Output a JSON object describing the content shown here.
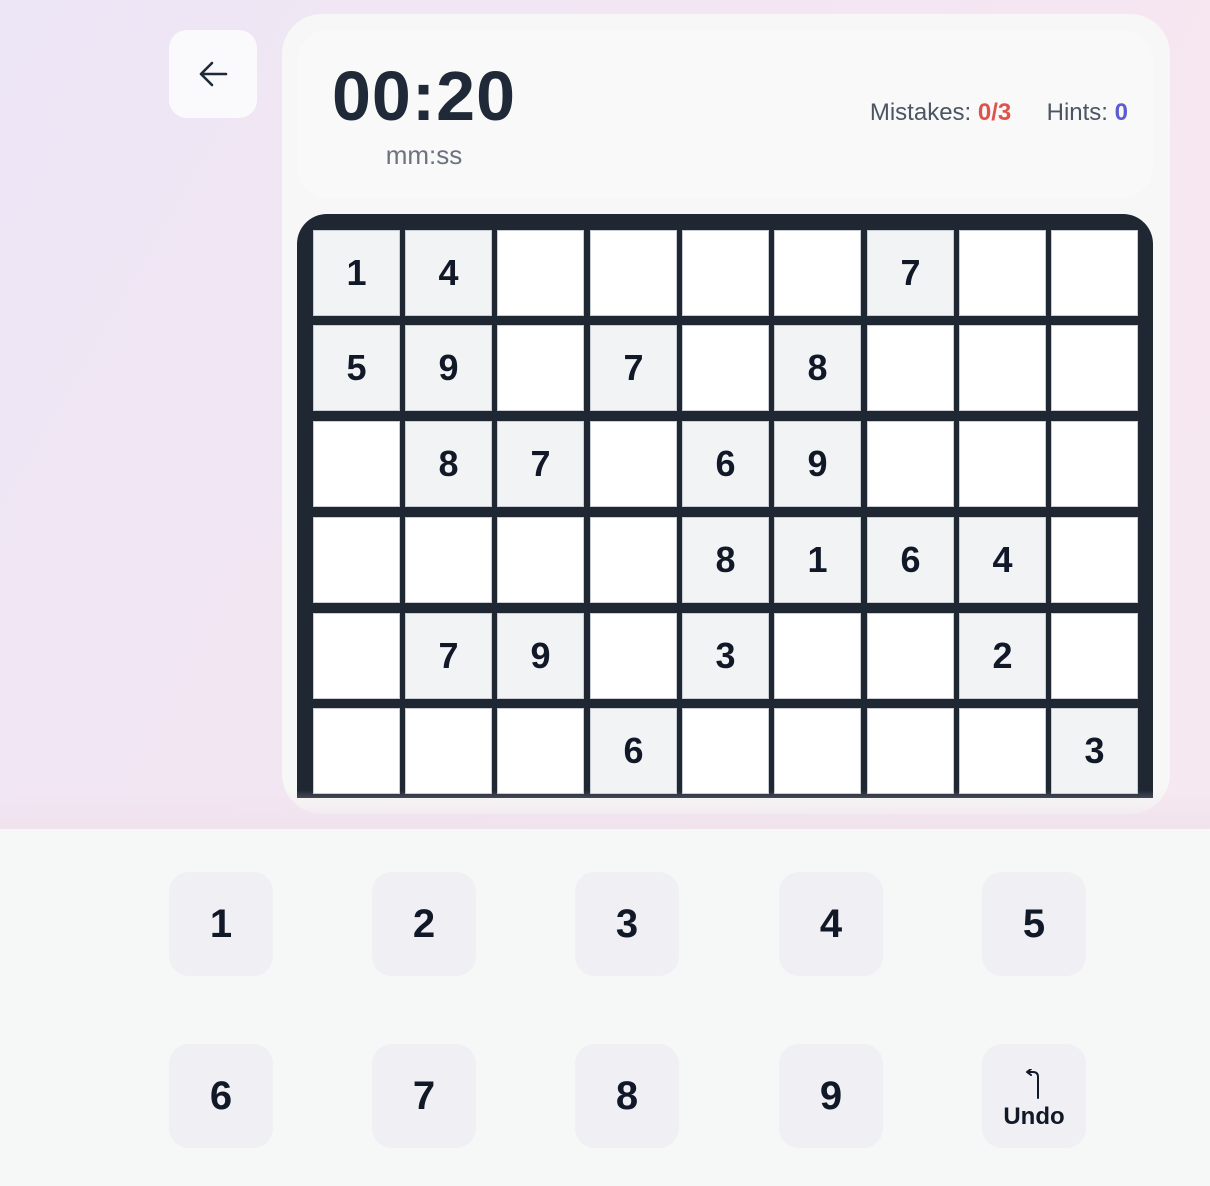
{
  "header": {
    "back_icon": "arrow-left-icon",
    "timer": "00:20",
    "timer_unit": "mm:ss",
    "mistakes_label": "Mistakes:",
    "mistakes_value": "0/3",
    "hints_label": "Hints:",
    "hints_value": "0"
  },
  "colors": {
    "mistakes": "#e0524a",
    "hints": "#5b5bd6",
    "board_border": "#1f2733"
  },
  "board": {
    "rows": [
      [
        "1",
        "4",
        "",
        "",
        "",
        "",
        "7",
        "",
        ""
      ],
      [
        "5",
        "9",
        "",
        "7",
        "",
        "8",
        "",
        "",
        ""
      ],
      [
        "",
        "8",
        "7",
        "",
        "6",
        "9",
        "",
        "",
        ""
      ],
      [
        "",
        "",
        "",
        "",
        "8",
        "1",
        "6",
        "4",
        ""
      ],
      [
        "",
        "7",
        "9",
        "",
        "3",
        "",
        "",
        "2",
        ""
      ],
      [
        "",
        "",
        "",
        "6",
        "",
        "",
        "",
        "",
        "3"
      ]
    ]
  },
  "keypad": {
    "keys": [
      "1",
      "2",
      "3",
      "4",
      "5",
      "6",
      "7",
      "8",
      "9"
    ],
    "undo_label": "Undo",
    "undo_icon": "undo-icon"
  }
}
